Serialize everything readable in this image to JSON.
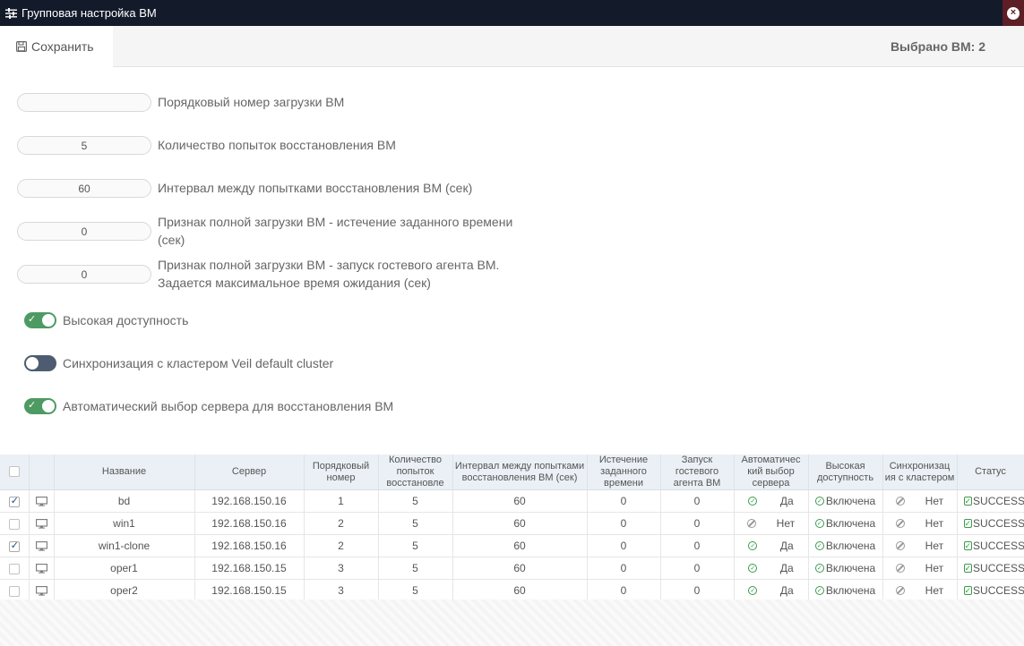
{
  "window": {
    "title": "Групповая настройка ВМ"
  },
  "toolbar": {
    "save_label": "Сохранить",
    "selected_text": "Выбрано ВМ: 2"
  },
  "fields": [
    {
      "value": "",
      "label": "Порядковый номер загрузки ВМ"
    },
    {
      "value": "5",
      "label": "Количество попыток восстановления ВМ"
    },
    {
      "value": "60",
      "label": "Интервал между попытками восстановления ВМ (сек)"
    },
    {
      "value": "0",
      "label_line1": "Признак полной загрузки ВМ - истечение заданного времени",
      "label_line2": "(сек)"
    },
    {
      "value": "0",
      "label_line1": "Признак полной загрузки ВМ - запуск гостевого агента ВМ.",
      "label_line2": "Задается максимальное время ожидания (сек)"
    }
  ],
  "toggles": [
    {
      "label": "Высокая доступность",
      "state": "on"
    },
    {
      "label": "Синхронизация с кластером Veil default cluster",
      "state": "off"
    },
    {
      "label": "Автоматический выбор сервера для восстановления ВМ",
      "state": "on"
    }
  ],
  "table": {
    "headers": {
      "name": "Название",
      "server": "Сервер",
      "order": "Порядковый номер",
      "attempts": "Количество попыток восстановле",
      "interval": "Интервал между попытками восстановления ВМ (сек)",
      "timeout": "Истечение заданного времени",
      "agent": "Запуск гостевого агента ВМ",
      "auto": "Автоматичес кий выбор сервера",
      "ha": "Высокая доступность",
      "sync": "Синхронизац ия с кластером",
      "status": "Статус"
    },
    "rows": [
      {
        "checked": true,
        "name": "bd",
        "server": "192.168.150.16",
        "order": "1",
        "attempts": "5",
        "interval": "60",
        "timeout": "0",
        "agent": "0",
        "auto": "Да",
        "auto_ok": true,
        "ha": "Включена",
        "sync": "Нет",
        "status": "SUCCESS"
      },
      {
        "checked": false,
        "name": "win1",
        "server": "192.168.150.16",
        "order": "2",
        "attempts": "5",
        "interval": "60",
        "timeout": "0",
        "agent": "0",
        "auto": "Нет",
        "auto_ok": false,
        "ha": "Включена",
        "sync": "Нет",
        "status": "SUCCESS"
      },
      {
        "checked": true,
        "name": "win1-clone",
        "server": "192.168.150.16",
        "order": "2",
        "attempts": "5",
        "interval": "60",
        "timeout": "0",
        "agent": "0",
        "auto": "Да",
        "auto_ok": true,
        "ha": "Включена",
        "sync": "Нет",
        "status": "SUCCESS"
      },
      {
        "checked": false,
        "name": "oper1",
        "server": "192.168.150.15",
        "order": "3",
        "attempts": "5",
        "interval": "60",
        "timeout": "0",
        "agent": "0",
        "auto": "Да",
        "auto_ok": true,
        "ha": "Включена",
        "sync": "Нет",
        "status": "SUCCESS"
      },
      {
        "checked": false,
        "name": "oper2",
        "server": "192.168.150.15",
        "order": "3",
        "attempts": "5",
        "interval": "60",
        "timeout": "0",
        "agent": "0",
        "auto": "Да",
        "auto_ok": true,
        "ha": "Включена",
        "sync": "Нет",
        "status": "SUCCESS"
      }
    ]
  },
  "colors": {
    "titlebar_bg": "#131b2b",
    "toggle_on": "#4e9a63",
    "toggle_off": "#4d5c70",
    "success_green": "#3b9a4a",
    "header_bg": "#eaf0f5"
  }
}
